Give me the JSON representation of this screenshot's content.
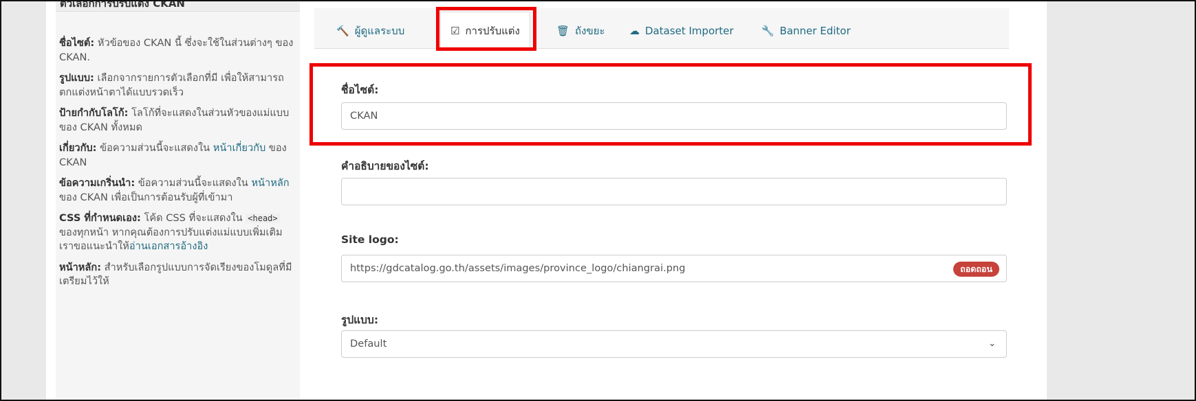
{
  "sidebar": {
    "heading": "ตัวเลือกการปรับแต่ง CKAN",
    "items": [
      {
        "term": "ชื่อไซต์:",
        "text": " หัวข้อของ CKAN นี้ ซึ่งจะใช้ในส่วนต่างๆ ของ CKAN."
      },
      {
        "term": "รูปแบบ:",
        "text": " เลือกจากรายการตัวเลือกที่มี เพื่อให้สามารถตกแต่งหน้าตาได้แบบรวดเร็ว"
      },
      {
        "term": "ป้ายกำกับโลโก้:",
        "text": " โลโก้ที่จะแสดงในส่วนหัวของแม่แบบของ CKAN ทั้งหมด"
      },
      {
        "term": "เกี่ยวกับ:",
        "text": " ข้อความส่วนนี้จะแสดงใน ",
        "link": "หน้าเกี่ยวกับ",
        "after": " ของ CKAN"
      },
      {
        "term": "ข้อความเกริ่นนำ:",
        "text": " ข้อความส่วนนี้จะแสดงใน ",
        "link": "หน้าหลัก",
        "after": " ของ CKAN เพื่อเป็นการต้อนรับผู้ที่เข้ามา"
      },
      {
        "term": "CSS ที่กำหนดเอง:",
        "text": " โค้ด CSS ที่จะแสดงใน ",
        "code": "<head>",
        "mid": " ของทุกหน้า หากคุณต้องการปรับแต่งแม่แบบเพิ่มเติม เราขอแนะนำให้",
        "link": "อ่านเอกสารอ้างอิง"
      },
      {
        "term": "หน้าหลัก:",
        "text": " สำหรับเลือกรูปแบบการจัดเรียงของโมดูลที่มีเตรียมไว้ให้"
      }
    ]
  },
  "tabs": [
    {
      "label": "ผู้ดูแลระบบ",
      "icon": "gavel-icon"
    },
    {
      "label": "การปรับแต่ง",
      "icon": "check-square-icon"
    },
    {
      "label": "ถังขยะ",
      "icon": "trash-icon"
    },
    {
      "label": "Dataset Importer",
      "icon": "cloud-upload-icon"
    },
    {
      "label": "Banner Editor",
      "icon": "wrench-icon"
    }
  ],
  "form": {
    "site_title_label": "ชื่อไซต์:",
    "site_title_value": "CKAN",
    "site_description_label": "คำอธิบายของไซต์:",
    "site_description_value": "",
    "site_logo_label": "Site logo:",
    "site_logo_value": "https://gdcatalog.go.th/assets/images/province_logo/chiangrai.png",
    "remove_label": "ถอดถอน",
    "style_label": "รูปแบบ:",
    "style_value": "Default"
  },
  "colors": {
    "link": "#206b82",
    "highlight": "#ee0000",
    "remove_button": "#c6423a"
  }
}
